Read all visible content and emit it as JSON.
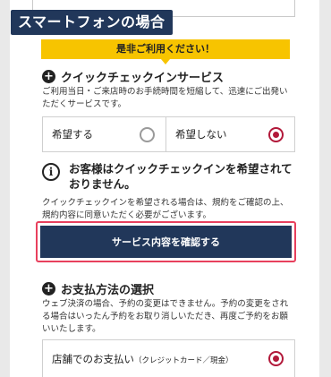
{
  "tag_label": "スマートフォンの場合",
  "banner": "是非ご利用ください！",
  "quick_checkin": {
    "title": "クイックチェックインサービス",
    "description": "ご利用当日・ご来店時のお手続時間を短縮して、迅速にご出発いただくサービスです。",
    "option_yes": "希望する",
    "option_no": "希望しない",
    "selected": "option_no"
  },
  "notice": {
    "title": "お客様はクイックチェックインを希望されておりません。",
    "body": "クイックチェックインを希望される場合は、規約をご確認の上、規約内容に同意いただく必要がございます。"
  },
  "cta_label": "サービス内容を確認する",
  "payment": {
    "title": "お支払方法の選択",
    "description": "ウェブ決済の場合、予約の変更はできません。予約の変更をされる場合はいったん予約をお取り消しいただき、再度ご予約をお願いいたします。",
    "option_store": "店舗でのお支払い",
    "option_store_note": "（クレジットカード／現金）"
  }
}
